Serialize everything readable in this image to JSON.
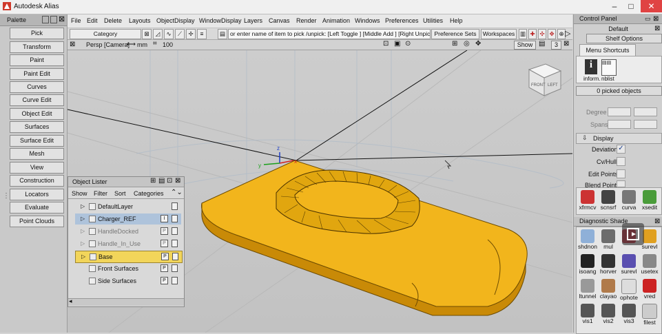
{
  "app": {
    "title": "Autodesk Alias",
    "window_controls": [
      "–",
      "□",
      "✕"
    ]
  },
  "palette": {
    "title": "Palette",
    "items": [
      "Pick",
      "Transform",
      "Paint",
      "Paint Edit",
      "Curves",
      "Curve Edit",
      "Object Edit",
      "Surfaces",
      "Surface Edit",
      "Mesh",
      "View",
      "Construction",
      "Locators",
      "Evaluate",
      "Point Clouds"
    ]
  },
  "menubar": {
    "items": [
      "File",
      "Edit",
      "Delete",
      "Layouts",
      "ObjectDisplay",
      "WindowDisplay",
      "Layers",
      "Canvas",
      "Render",
      "Animation",
      "Windows",
      "Preferences",
      "Utilities",
      "Help"
    ]
  },
  "toolbar": {
    "category_label": "Category",
    "prompt": "or enter name of item to pick /unpick: [Left Toggle ] [Middle Add ] [Right Unpick ]",
    "preference_sets": "Preference Sets",
    "workspaces": "Workspaces"
  },
  "viewport": {
    "camera": "Persp [Camera]",
    "units": "mm",
    "grid_value": "100",
    "show_label": "Show",
    "layer_number": "3",
    "viewcube_front": "FRONT",
    "viewcube_left": "LEFT",
    "axis_z": "z",
    "axis_y": "y",
    "axis_x": "x",
    "colors": {
      "background": "#c7c7c7",
      "model": "#f2b51c",
      "model_dark": "#c98a07"
    }
  },
  "object_lister": {
    "title": "Object Lister",
    "menu": [
      "Show",
      "Filter",
      "Sort",
      "Categories"
    ],
    "rows": [
      {
        "name": "DefaultLayer",
        "tag": "",
        "arrow": true,
        "selected": false,
        "dim": false
      },
      {
        "name": "Charger_REF",
        "tag": "I",
        "arrow": true,
        "selected": true,
        "dim": false
      },
      {
        "name": "HandleDocked",
        "tag": "P",
        "arrow": true,
        "selected": false,
        "dim": true
      },
      {
        "name": "Handle_In_Use",
        "tag": "P",
        "arrow": true,
        "selected": false,
        "dim": true
      },
      {
        "name": "Base",
        "tag": "P",
        "arrow": true,
        "selected": false,
        "highlight": true,
        "dim": false
      },
      {
        "name": "Front Surfaces",
        "tag": "P",
        "arrow": false,
        "selected": false,
        "dim": false
      },
      {
        "name": "Side Surfaces",
        "tag": "P",
        "arrow": false,
        "selected": false,
        "dim": false
      }
    ]
  },
  "control_panel": {
    "title": "Control Panel",
    "default_label": "Default",
    "shelf_options": "Shelf Options",
    "menu_shortcuts": "Menu Shortcuts",
    "shortcut_labels": [
      "inform.",
      "nblist"
    ],
    "picked": "0 picked objects",
    "degree_label": "Degree",
    "spans_label": "Spans",
    "display_label": "Display",
    "display_items": [
      {
        "label": "Deviation",
        "checked": true
      },
      {
        "label": "Cv/Hull",
        "checked": false
      },
      {
        "label": "Edit Points",
        "checked": false
      },
      {
        "label": "Blend Points",
        "checked": false
      }
    ],
    "tools_row": [
      "xfrmcv",
      "scnsrf",
      "curva",
      "xsedit"
    ],
    "diagnostic_title": "Diagnostic Shade",
    "diag_row1": [
      "shdnon",
      "mul",
      "",
      "surevl"
    ],
    "diag_row2": [
      "isoang",
      "horver",
      "surevl",
      "usetex"
    ],
    "diag_row3": [
      "ltunnel",
      "clayao",
      "ophote",
      "vred"
    ],
    "diag_row4": [
      "vis1",
      "vis2",
      "vis3",
      "filest"
    ]
  }
}
